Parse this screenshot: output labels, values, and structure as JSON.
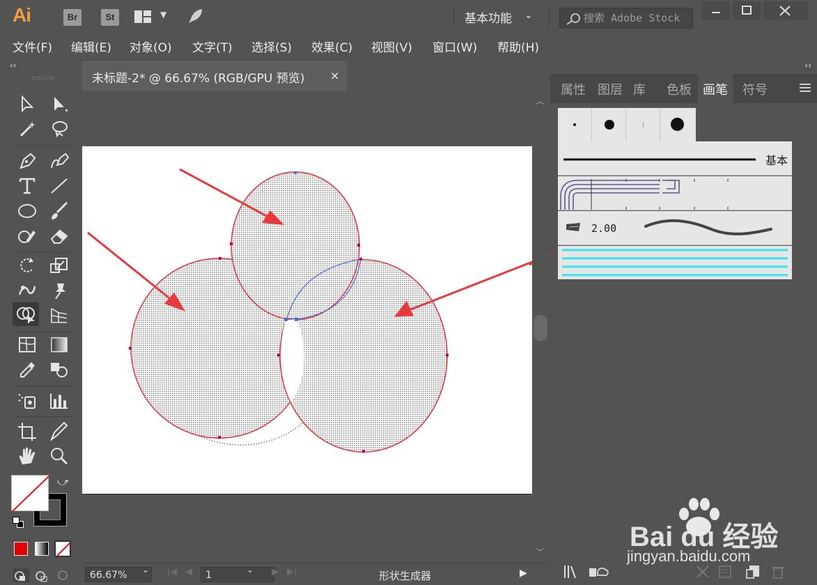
{
  "app": {
    "logo": "Ai",
    "bridge_badge": "Br",
    "stock_badge": "St",
    "workspace": "基本功能",
    "search_placeholder": "搜索 Adobe Stock"
  },
  "menu": [
    "文件(F)",
    "编辑(E)",
    "对象(O)",
    "文字(T)",
    "选择(S)",
    "效果(C)",
    "视图(V)",
    "窗口(W)",
    "帮助(H)"
  ],
  "document": {
    "tab_title": "未标题-2* @ 66.67% (RGB/GPU 预览)",
    "close_glyph": "×"
  },
  "status": {
    "zoom": "66.67%",
    "page": "1",
    "tool_name": "形状生成器"
  },
  "right_panel": {
    "tabs": [
      "属性",
      "图层",
      "库",
      "色板",
      "画笔",
      "符号"
    ],
    "active_tab": "画笔",
    "basic_brush_label": "基本",
    "brush_size": "2.00"
  },
  "tools": {
    "active": "shape-builder-tool",
    "fill_color": "#ffffff",
    "stroke_color": "#000000",
    "color_mode_swatch": "#e30000"
  },
  "watermark": {
    "brand": "Bai du 经验",
    "url": "jingyan.baidu.com"
  },
  "colors": {
    "accent_arrow": "#e8393c",
    "path_outline": "#d9363e",
    "selection": "#4a6cd4",
    "pattern_brush": "#33e5ee"
  }
}
